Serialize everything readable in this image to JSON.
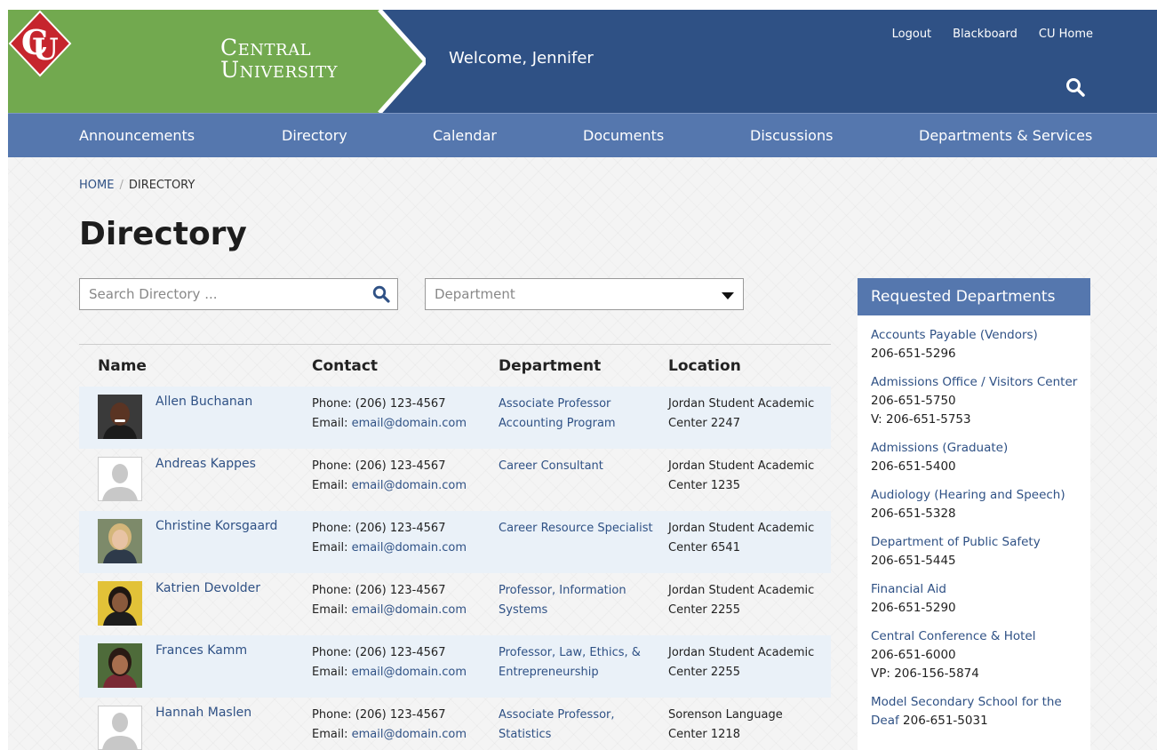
{
  "header": {
    "logo_line1": "Central",
    "logo_line2": "University",
    "welcome": "Welcome, Jennifer",
    "util_links": [
      "Logout",
      "Blackboard",
      "CU Home"
    ],
    "search_icon": "search-icon",
    "colors": {
      "header_bg": "#2f5185",
      "logo_bg": "#72a94f",
      "nav_bg": "#5577ae",
      "logo_red": "#c6252d"
    }
  },
  "nav": {
    "items": [
      "Announcements",
      "Directory",
      "Calendar",
      "Documents",
      "Discussions",
      "Departments & Services"
    ]
  },
  "breadcrumb": {
    "home": "HOME",
    "separator": "/",
    "current": "DIRECTORY"
  },
  "page_title": "Directory",
  "search": {
    "placeholder": "Search Directory ...",
    "value": "",
    "icon": "search-icon"
  },
  "department_select": {
    "selected": "Department",
    "icon": "caret-down-icon"
  },
  "table": {
    "headers": [
      "Name",
      "Contact",
      "Department",
      "Location"
    ],
    "rows": [
      {
        "name": "Allen Buchanan",
        "phone": "Phone: (206) 123-4567",
        "email_label": "Email:",
        "email": "email@domain.com",
        "department": "Associate Professor Accounting Program",
        "location": "Jordan Student Academic Center 2247",
        "photo": "photo"
      },
      {
        "name": "Andreas Kappes",
        "phone": "Phone: (206) 123-4567",
        "email_label": "Email:",
        "email": "email@domain.com",
        "department": "Career Consultant",
        "location": "Jordan Student Academic Center 1235",
        "photo": "placeholder"
      },
      {
        "name": "Christine Korsgaard",
        "phone": "Phone: (206) 123-4567",
        "email_label": "Email:",
        "email": "email@domain.com",
        "department": "Career Resource Specialist",
        "location": "Jordan Student Academic Center 6541",
        "photo": "photo"
      },
      {
        "name": "Katrien Devolder",
        "phone": "Phone: (206) 123-4567",
        "email_label": "Email:",
        "email": "email@domain.com",
        "department": "Professor, Information Systems",
        "location": "Jordan Student Academic Center 2255",
        "photo": "photo"
      },
      {
        "name": "Frances Kamm",
        "phone": "Phone: (206) 123-4567",
        "email_label": "Email:",
        "email": "email@domain.com",
        "department": "Professor, Law, Ethics, & Entrepreneurship",
        "location": "Jordan Student Academic Center 2255",
        "photo": "photo"
      },
      {
        "name": "Hannah Maslen",
        "phone": "Phone: (206) 123-4567",
        "email_label": "Email:",
        "email": "email@domain.com",
        "department": "Associate Professor, Statistics",
        "location": "Sorenson Language Center 1218",
        "photo": "placeholder"
      }
    ]
  },
  "sidebar": {
    "title": "Requested Departments",
    "items": [
      {
        "link": "Accounts Payable (Vendors)",
        "inline": "",
        "lines": [
          "206-651-5296"
        ]
      },
      {
        "link": "Admissions Office / Visitors Center",
        "inline": "206-651-5750",
        "lines": [
          "V: 206-651-5753"
        ]
      },
      {
        "link": "Admissions (Graduate)",
        "inline": "",
        "lines": [
          "206-651-5400"
        ]
      },
      {
        "link": "Audiology (Hearing and Speech)",
        "inline": "",
        "lines": [
          "206-651-5328"
        ]
      },
      {
        "link": "Department of Public Safety",
        "inline": "",
        "lines": [
          "206-651-5445"
        ]
      },
      {
        "link": "Financial Aid",
        "inline": "",
        "lines": [
          "206-651-5290"
        ]
      },
      {
        "link": "Central Conference & Hotel",
        "inline": "",
        "lines": [
          "206-651-6000",
          "VP: 206-156-5874"
        ]
      },
      {
        "link": "Model Secondary School for the Deaf",
        "inline": "206-651-5031",
        "lines": []
      }
    ]
  }
}
